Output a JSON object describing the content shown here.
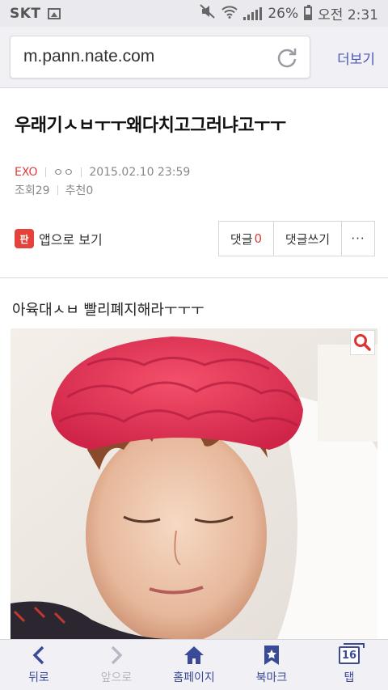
{
  "status_bar": {
    "carrier": "SKT",
    "battery": "26%",
    "time": "오전 2:31",
    "battery_level": 0.26
  },
  "browser": {
    "url": "m.pann.nate.com",
    "more_label": "더보기"
  },
  "article": {
    "title": "우래기ㅅㅂㅜㅜ왜다치고그러냐고ㅜㅜ",
    "category": "EXO",
    "author": "ㅇㅇ",
    "datetime": "2015.02.10 23:59",
    "views": "조회29",
    "likes": "추천0",
    "body": "아육대ㅅㅂ 빨리폐지해라ㅜㅜㅜ"
  },
  "actions": {
    "app_view": "앱으로 보기",
    "comment_label": "댓글",
    "comment_count": "0",
    "write_comment": "댓글쓰기",
    "more_dots": "···"
  },
  "bottom_nav": {
    "back": "뒤로",
    "forward": "앞으로",
    "home": "홈페이지",
    "bookmark": "북마크",
    "tabs": "탭",
    "tab_count": "16"
  },
  "colors": {
    "accent": "#3b4a97",
    "category_red": "#e03c3c",
    "app_icon": "#e4433b"
  },
  "icons": {
    "status": [
      "image-icon",
      "mute-icon",
      "wifi-icon",
      "signal-icon",
      "battery-icon"
    ],
    "nav": [
      "chevron-left-icon",
      "chevron-right-icon",
      "home-icon",
      "bookmark-icon",
      "tabs-icon"
    ]
  }
}
